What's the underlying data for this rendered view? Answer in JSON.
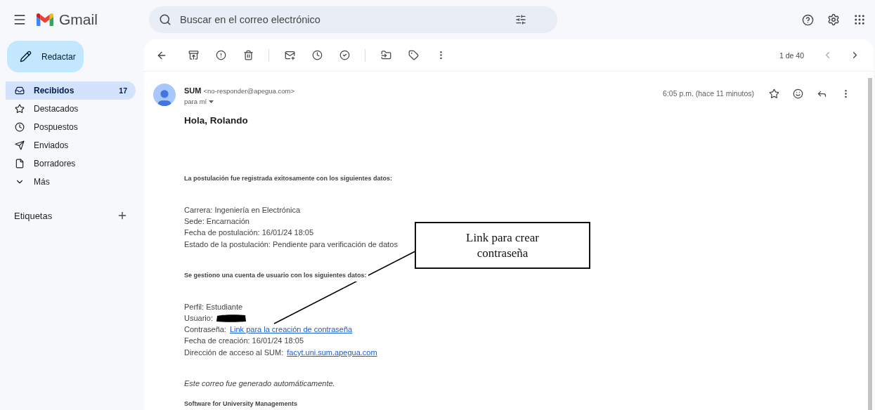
{
  "app": {
    "name": "Gmail"
  },
  "search": {
    "placeholder": "Buscar en el correo electrónico"
  },
  "compose": {
    "label": "Redactar"
  },
  "sidebar": {
    "items": [
      {
        "label": "Recibidos",
        "count": "17",
        "selected": true
      },
      {
        "label": "Destacados",
        "selected": false
      },
      {
        "label": "Pospuestos",
        "selected": false
      },
      {
        "label": "Enviados",
        "selected": false
      },
      {
        "label": "Borradores",
        "selected": false
      },
      {
        "label": "Más",
        "selected": false
      }
    ],
    "labels_heading": "Etiquetas"
  },
  "pager": {
    "position": "1 de 40"
  },
  "message": {
    "sender": "SUM",
    "address": "<no-responder@apegua.com>",
    "recipient": "para mí",
    "time": "6:05 p.m. (hace 11 minutos)",
    "starred": false,
    "sections": [
      {
        "kind": "greeting",
        "lines": [
          {
            "text": "Hola, Rolando"
          }
        ]
      },
      {
        "kind": "heading",
        "lines": [
          {
            "text": "La postulación fue registrada exitosamente con los siguientes datos:"
          }
        ]
      },
      {
        "kind": "details",
        "lines": [
          {
            "text": "Carrera: Ingeniería en Electrónica"
          },
          {
            "text": "Sede: Encarnación"
          },
          {
            "text": "Fecha de postulación: 16/01/24 18:05"
          },
          {
            "text": "Estado de la postulación: Pendiente para verificación de datos"
          }
        ]
      },
      {
        "kind": "heading",
        "lines": [
          {
            "text": "Se gestiono una cuenta de usuario con los siguientes datos:"
          }
        ]
      },
      {
        "kind": "details",
        "lines": [
          {
            "text": "Perfil: Estudiante"
          },
          {
            "text": "Usuario:",
            "redacted": true
          },
          {
            "text": "Contraseña:",
            "link": "Link para la creación de contraseña"
          },
          {
            "text": "Fecha de creación: 16/01/24 18:05"
          },
          {
            "text": "Dirección de acceso al SUM:",
            "link": "facyt.uni.sum.apegua.com"
          }
        ]
      },
      {
        "kind": "note",
        "lines": [
          {
            "text": "Este correo fue generado automáticamente."
          }
        ]
      },
      {
        "kind": "signature",
        "lines": [
          {
            "text": "Software for University Managements"
          }
        ]
      }
    ]
  },
  "callout": {
    "text": "Link para crear contraseña"
  }
}
